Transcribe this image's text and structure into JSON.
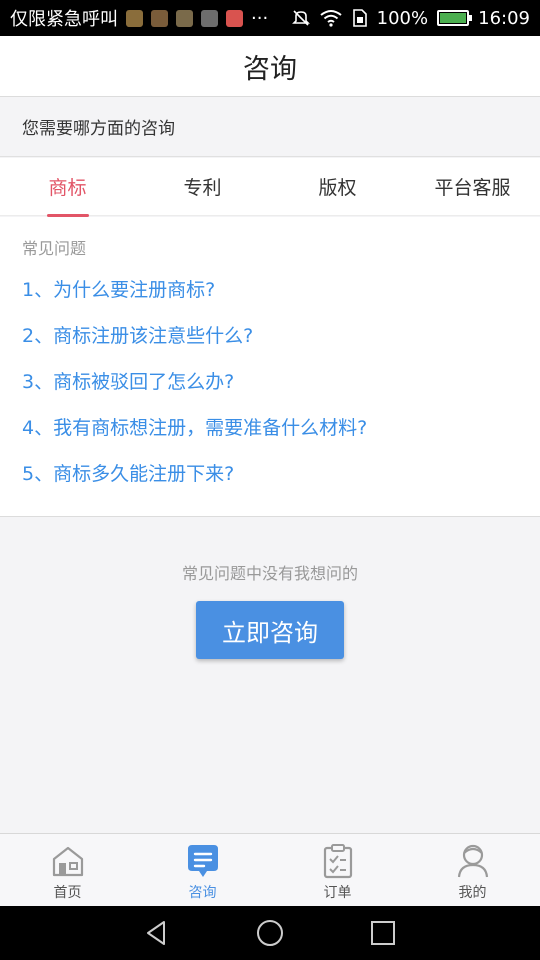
{
  "statusbar": {
    "carrier": "仅限紧急呼叫",
    "battery": "100%",
    "battery_level": 1.0,
    "time": "16:09",
    "notification_colors": [
      "#8a6d3b",
      "#7a5c3a",
      "#7a6a4a",
      "#6d6d6d",
      "#d9534f"
    ]
  },
  "titlebar": {
    "title": "咨询"
  },
  "prompt": {
    "text": "您需要哪方面的咨询"
  },
  "tabs": [
    {
      "label": "商标",
      "active": true
    },
    {
      "label": "专利",
      "active": false
    },
    {
      "label": "版权",
      "active": false
    },
    {
      "label": "平台客服",
      "active": false
    }
  ],
  "faq": {
    "title": "常见问题",
    "items": [
      "1、为什么要注册商标?",
      "2、商标注册该注意些什么?",
      "3、商标被驳回了怎么办?",
      "4、我有商标想注册，需要准备什么材料?",
      "5、商标多久能注册下来?"
    ]
  },
  "empty_note": "常见问题中没有我想问的",
  "consult_button": "立即咨询",
  "bottomnav": [
    {
      "label": "首页",
      "icon": "home-icon",
      "active": false
    },
    {
      "label": "咨询",
      "icon": "chat-icon",
      "active": true
    },
    {
      "label": "订单",
      "icon": "clipboard-icon",
      "active": false
    },
    {
      "label": "我的",
      "icon": "user-icon",
      "active": false
    }
  ],
  "colors": {
    "accent_red": "#e25567",
    "accent_blue": "#4a90e2",
    "link_blue": "#3a8ee6"
  }
}
